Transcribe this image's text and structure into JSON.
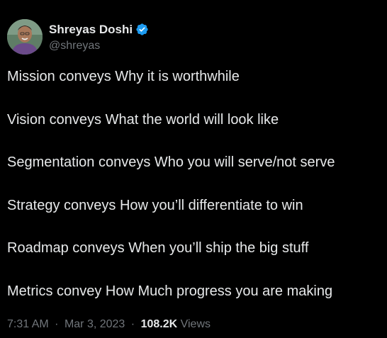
{
  "author": {
    "display_name": "Shreyas Doshi",
    "handle": "@shreyas",
    "verified": true,
    "verified_color": "#1d9bf0"
  },
  "tweet": {
    "lines": [
      "Mission conveys Why it is worthwhile",
      "Vision conveys What the world will look like",
      "Segmentation conveys Who you will serve/not serve",
      "Strategy conveys How you’ll differentiate to win",
      "Roadmap conveys When you’ll ship the big stuff",
      "Metrics convey How Much progress you are making"
    ]
  },
  "meta": {
    "time": "7:31 AM",
    "separator": "·",
    "date": "Mar 3, 2023",
    "views_count": "108.2K",
    "views_label": "Views"
  },
  "colors": {
    "background": "#000000",
    "text_primary": "#e7e9ea",
    "text_secondary": "#71767b"
  }
}
